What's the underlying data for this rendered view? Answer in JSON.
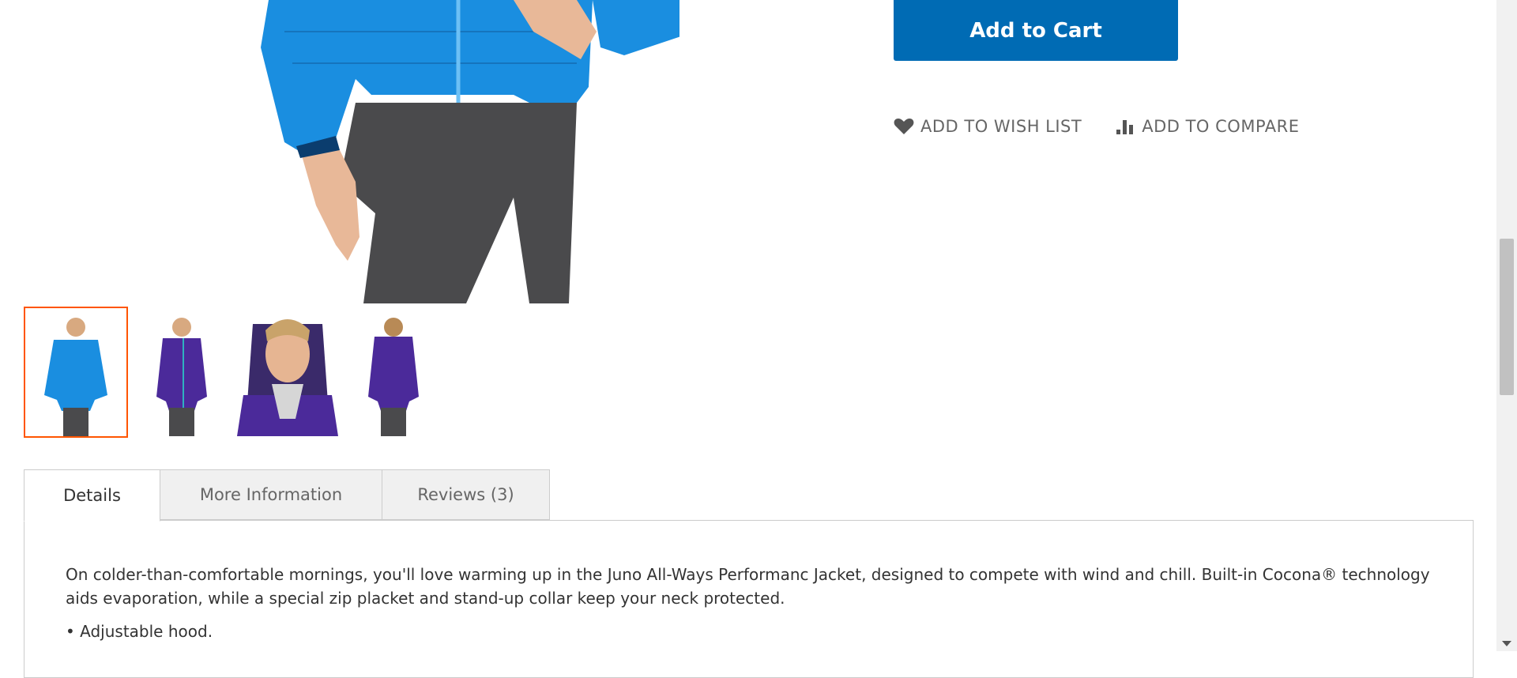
{
  "product": {
    "main_image_alt": "Juno jacket main view",
    "thumbnails": [
      {
        "name": "blue-front",
        "color": "#1a8ee0"
      },
      {
        "name": "purple-front",
        "color": "#4b2a9a"
      },
      {
        "name": "purple-closeup",
        "color": "#4b2a9a"
      },
      {
        "name": "purple-back",
        "color": "#4b2a9a"
      }
    ]
  },
  "actions": {
    "add_to_cart": "Add to Cart",
    "wish_list": "ADD TO WISH LIST",
    "compare": "ADD TO COMPARE",
    "wish_icon": "heart-icon",
    "compare_icon": "bar-chart-icon"
  },
  "tabs": [
    {
      "label": "Details"
    },
    {
      "label": "More Information"
    },
    {
      "label": "Reviews (3)"
    }
  ],
  "details": {
    "description": "On colder-than-comfortable mornings, you'll love warming up in the Juno All-Ways Performanc Jacket, designed to compete with wind and chill. Built-in Cocona® technology aids evaporation, while a special zip placket and stand-up collar keep your neck protected.",
    "bullet_1": "• Adjustable hood."
  },
  "colors": {
    "primary_button": "#006bb4",
    "active_thumb_border": "#ff5501",
    "jacket_blue": "#1a8ee0",
    "jacket_purple": "#4b2a9a"
  }
}
